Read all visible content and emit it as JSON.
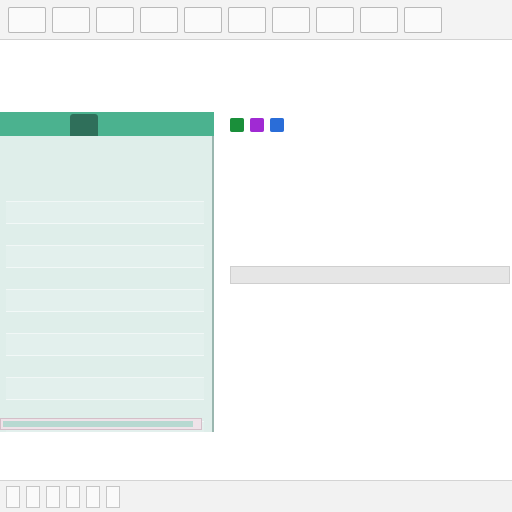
{
  "toolbar": {
    "buttons": [
      "",
      "",
      "",
      "",
      "",
      "",
      "",
      "",
      "",
      ""
    ]
  },
  "header": {
    "app_title": "",
    "subtitle": ""
  },
  "left_panel": {
    "header": [
      "",
      ""
    ],
    "items": [
      {
        "label": "",
        "value": ""
      },
      {
        "label": "",
        "value": ""
      },
      {
        "label": "",
        "value": ""
      },
      {
        "label": "",
        "value": ""
      },
      {
        "label": "",
        "value": ""
      },
      {
        "label": "",
        "value": ""
      },
      {
        "label": "",
        "value": ""
      },
      {
        "label": "",
        "value": ""
      },
      {
        "label": "",
        "value": ""
      },
      {
        "label": "",
        "value": ""
      },
      {
        "label": "",
        "value": ""
      },
      {
        "label": "",
        "value": ""
      },
      {
        "label": "",
        "value": ""
      },
      {
        "label": "",
        "value": ""
      }
    ]
  },
  "right_panel": {
    "title": "",
    "subtitle": "",
    "lines": [
      "",
      "",
      "",
      ""
    ],
    "table_header": "",
    "table_rows": [
      {
        "c1": "",
        "c2": ""
      },
      {
        "c1": "",
        "c2": ""
      },
      {
        "c1": "",
        "c2": ""
      },
      {
        "c1": "",
        "c2": ""
      },
      {
        "c1": "",
        "c2": ""
      }
    ],
    "footer_text": ""
  },
  "bottom": {
    "text": "",
    "footer_buttons": [
      "",
      "",
      "",
      "",
      "",
      ""
    ]
  },
  "colors": {
    "toolbar_bg": "#f3f3f3",
    "left_panel_bg": "#dfeeea",
    "left_panel_header": "#4bb28f",
    "accent_green": "#1a8f3a",
    "accent_purple": "#a02ad3",
    "accent_blue": "#2a6dd8"
  },
  "icons": {
    "left_header_tab": "folder-tab-icon"
  }
}
